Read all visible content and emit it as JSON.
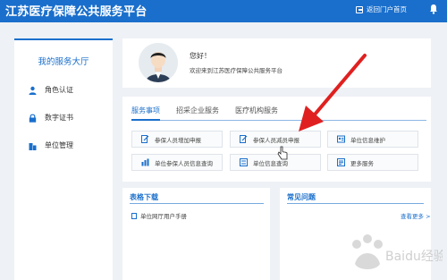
{
  "header": {
    "title": "江苏医疗保障公共服务平台",
    "portal_link": "返回门户首页"
  },
  "sidebar": {
    "title": "我的服务大厅",
    "items": [
      {
        "label": "角色认证",
        "icon": "user-icon"
      },
      {
        "label": "数字证书",
        "icon": "lock-icon"
      },
      {
        "label": "单位管理",
        "icon": "building-icon"
      }
    ]
  },
  "profile": {
    "greeting": "您好！",
    "welcome": "欢迎来到江苏医疗保障公共服务平台"
  },
  "services": {
    "tabs": [
      "服务事项",
      "招采企业服务",
      "医疗机构服务"
    ],
    "active_tab": "服务事项",
    "items": [
      {
        "label": "参保人员增加申报",
        "icon": "edit-doc-icon"
      },
      {
        "label": "参保人员减员申报",
        "icon": "edit-doc-icon"
      },
      {
        "label": "单位信息维护",
        "icon": "id-card-icon"
      },
      {
        "label": "单位参保人员信息查询",
        "icon": "chart-icon"
      },
      {
        "label": "单位信息查询",
        "icon": "swap-icon"
      },
      {
        "label": "更多服务",
        "icon": "list-icon"
      }
    ]
  },
  "downloads": {
    "title": "表格下载",
    "items": [
      "单位网厅用户手册"
    ]
  },
  "faq": {
    "title": "常见问题",
    "more": "查看更多 >"
  },
  "watermark": "Baidu经验",
  "colors": {
    "brand_blue": "#1a6fcc",
    "arrow_red": "#e02020",
    "background": "#eef1f5"
  }
}
